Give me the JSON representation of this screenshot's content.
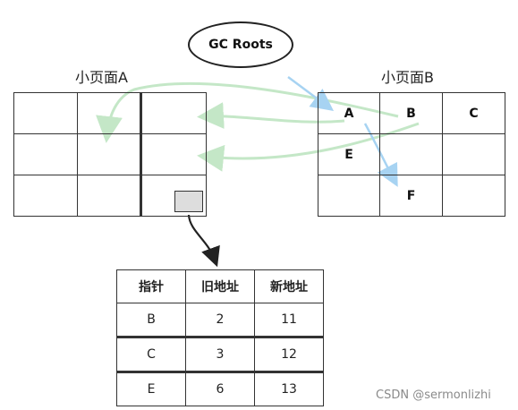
{
  "gc_roots": "GC Roots",
  "page_a": {
    "label": "小页面A"
  },
  "page_b": {
    "label": "小页面B",
    "cells": {
      "A": "A",
      "B": "B",
      "C": "C",
      "E": "E",
      "F": "F"
    }
  },
  "forwarding_table": {
    "headers": [
      "指针",
      "旧地址",
      "新地址"
    ],
    "rows": [
      [
        "B",
        "2",
        "11"
      ],
      [
        "C",
        "3",
        "12"
      ],
      [
        "E",
        "6",
        "13"
      ]
    ]
  },
  "watermark": "CSDN @sermonlizhi",
  "colors": {
    "arrow_blue": "#a7d3f2",
    "arrow_green": "#c4e7c7",
    "pointer_fill": "#dddddd"
  }
}
